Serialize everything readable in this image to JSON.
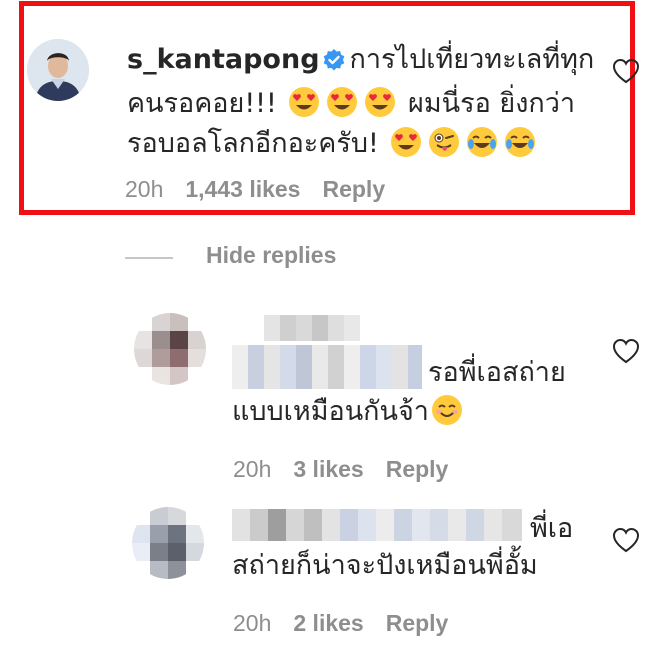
{
  "main_comment": {
    "username": "s_kantapong",
    "line1": "การไปเที่ยวทะเลที่ทุก",
    "line2_text": "คนรอคอย!!!",
    "line2_tail": "ผมนี่รอ ยิ่งกว่า",
    "line3_text": "รอบอลโลกอีกอะครับ!",
    "time": "20h",
    "likes": "1,443 likes",
    "reply": "Reply"
  },
  "hide_replies": "Hide replies",
  "reply1": {
    "text_line1": "รอพี่เอสถ่าย",
    "text_line2": "แบบเหมือนกันจ้า",
    "time": "20h",
    "likes": "3 likes",
    "reply": "Reply"
  },
  "reply2": {
    "text_line1": "พี่เอ",
    "text_line2": "สถ่ายก็น่าจะปังเหมือนพี่อั้ม",
    "time": "20h",
    "likes": "2 likes",
    "reply": "Reply"
  },
  "colors": {
    "highlight_border": "#ef0f14",
    "verified_blue": "#3897f0",
    "meta_gray": "#8e8e8e"
  },
  "icons": [
    "heart-icon",
    "verified-badge-icon",
    "heart-eyes-emoji",
    "winking-tongue-emoji",
    "tears-of-joy-emoji",
    "smiling-emoji"
  ]
}
